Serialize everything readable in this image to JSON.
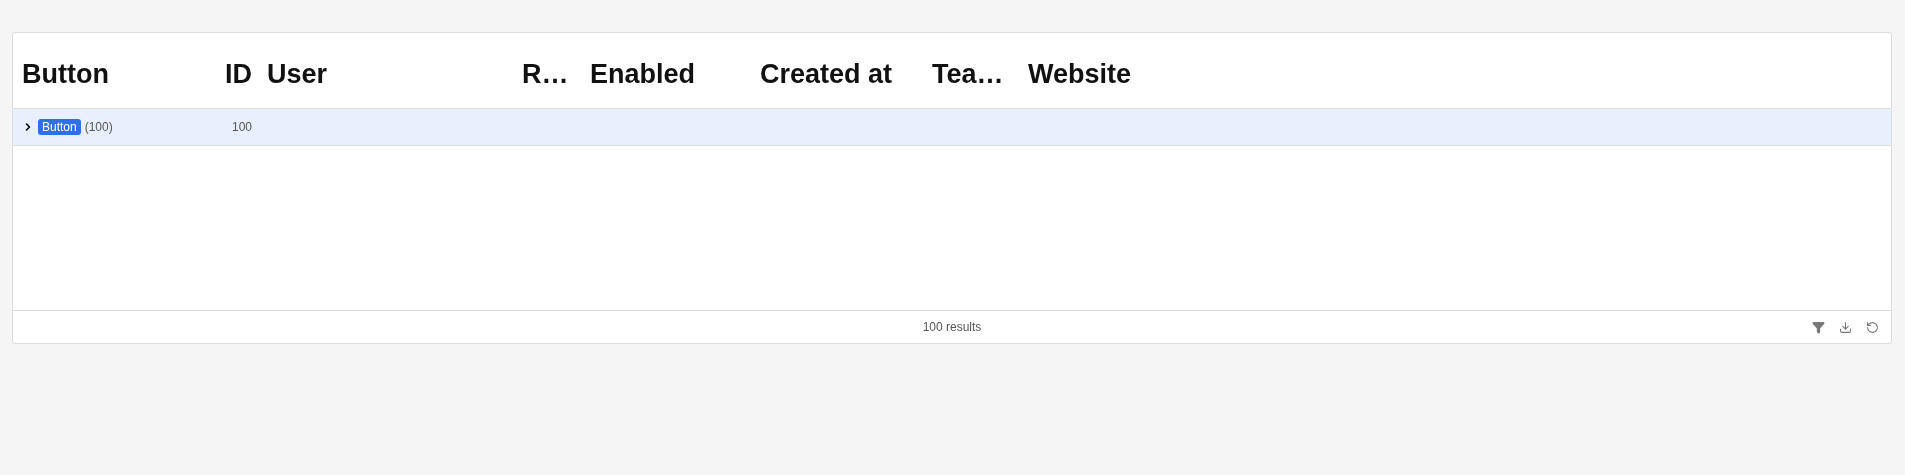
{
  "table": {
    "columns": [
      {
        "label": "Button"
      },
      {
        "label": "ID"
      },
      {
        "label": "User"
      },
      {
        "label": "R…"
      },
      {
        "label": "Enabled"
      },
      {
        "label": "Created at"
      },
      {
        "label": "Tea…"
      },
      {
        "label": "Website"
      }
    ],
    "groups": [
      {
        "tag": "Button",
        "count": "(100)",
        "id": "100",
        "expanded": false,
        "selected": true
      }
    ]
  },
  "footer": {
    "results": "100 results"
  }
}
